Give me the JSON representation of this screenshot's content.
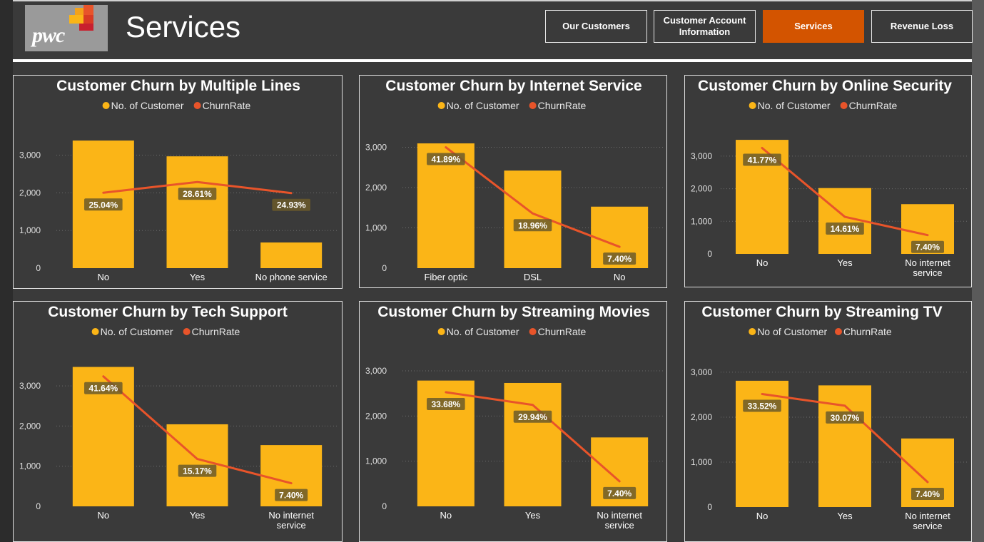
{
  "header": {
    "title": "Services",
    "logo_text": "pwc",
    "nav": [
      {
        "label": "Our Customers",
        "active": false
      },
      {
        "label": "Customer Account Information",
        "active": false
      },
      {
        "label": "Services",
        "active": true
      },
      {
        "label": "Revenue Loss",
        "active": false
      }
    ]
  },
  "colors": {
    "bar": "#fbb517",
    "line": "#e8542a",
    "background": "#3a3a3a",
    "active_nav": "#d35400"
  },
  "chart_data": [
    {
      "type": "bar",
      "title": "Customer Churn by Multiple Lines",
      "legend": [
        "No. of Customer",
        "ChurnRate"
      ],
      "categories": [
        "No",
        "Yes",
        "No phone service"
      ],
      "category_lines": [
        [
          "No"
        ],
        [
          "Yes"
        ],
        [
          "No phone service"
        ]
      ],
      "series": [
        {
          "name": "No. of Customer",
          "values": [
            3390,
            2971,
            682
          ]
        },
        {
          "name": "ChurnRate",
          "values": [
            25.04,
            28.61,
            24.93
          ],
          "labels": [
            "25.04%",
            "28.61%",
            "24.93%"
          ]
        }
      ],
      "yticks": [
        "0",
        "1,000",
        "2,000",
        "3,000"
      ],
      "ylim": [
        0,
        3600
      ],
      "rate_range": [
        0,
        45
      ],
      "legend_position": "top-center"
    },
    {
      "type": "bar",
      "title": "Customer Churn by Internet Service",
      "legend": [
        "No. of Customer",
        "ChurnRate"
      ],
      "categories": [
        "Fiber optic",
        "DSL",
        "No"
      ],
      "category_lines": [
        [
          "Fiber optic"
        ],
        [
          "DSL"
        ],
        [
          "No"
        ]
      ],
      "series": [
        {
          "name": "No. of Customer",
          "values": [
            3096,
            2421,
            1526
          ]
        },
        {
          "name": "ChurnRate",
          "values": [
            41.89,
            18.96,
            7.4
          ],
          "labels": [
            "41.89%",
            "18.96%",
            "7.40%"
          ]
        }
      ],
      "yticks": [
        "0",
        "1,000",
        "2,000",
        "3,000"
      ],
      "ylim": [
        0,
        3150
      ],
      "rate_range": [
        0,
        44
      ],
      "legend_position": "top-center"
    },
    {
      "type": "bar",
      "title": "Customer Churn by Online Security",
      "legend": [
        "No. of Customer",
        "ChurnRate"
      ],
      "categories": [
        "No",
        "Yes",
        "No internet service"
      ],
      "category_lines": [
        [
          "No"
        ],
        [
          "Yes"
        ],
        [
          "No internet",
          "service"
        ]
      ],
      "series": [
        {
          "name": "No. of Customer",
          "values": [
            3498,
            2019,
            1526
          ]
        },
        {
          "name": "ChurnRate",
          "values": [
            41.77,
            14.61,
            7.4
          ],
          "labels": [
            "41.77%",
            "14.61%",
            "7.40%"
          ]
        }
      ],
      "yticks": [
        "0",
        "1,000",
        "2,000",
        "3,000"
      ],
      "ylim": [
        0,
        3500
      ],
      "rate_range": [
        0,
        45
      ],
      "legend_position": "top-center"
    },
    {
      "type": "bar",
      "title": "Customer Churn by Tech Support",
      "legend": [
        "No. of Customer",
        "ChurnRate"
      ],
      "categories": [
        "No",
        "Yes",
        "No internet service"
      ],
      "category_lines": [
        [
          "No"
        ],
        [
          "Yes"
        ],
        [
          "No internet",
          "service"
        ]
      ],
      "series": [
        {
          "name": "No. of Customer",
          "values": [
            3473,
            2044,
            1526
          ]
        },
        {
          "name": "ChurnRate",
          "values": [
            41.64,
            15.17,
            7.4
          ],
          "labels": [
            "41.64%",
            "15.17%",
            "7.40%"
          ]
        }
      ],
      "yticks": [
        "0",
        "1,000",
        "2,000",
        "3,000"
      ],
      "ylim": [
        0,
        3500
      ],
      "rate_range": [
        0,
        45
      ],
      "legend_position": "top-center"
    },
    {
      "type": "bar",
      "title": "Customer Churn by Streaming Movies",
      "legend": [
        "No. of Customer",
        "ChurnRate"
      ],
      "categories": [
        "No",
        "Yes",
        "No internet service"
      ],
      "category_lines": [
        [
          "No"
        ],
        [
          "Yes"
        ],
        [
          "No internet",
          "service"
        ]
      ],
      "series": [
        {
          "name": "No. of Customer",
          "values": [
            2785,
            2732,
            1526
          ]
        },
        {
          "name": "ChurnRate",
          "values": [
            33.68,
            29.94,
            7.4
          ],
          "labels": [
            "33.68%",
            "29.94%",
            "7.40%"
          ]
        }
      ],
      "yticks": [
        "0",
        "1,000",
        "2,000",
        "3,000"
      ],
      "ylim": [
        0,
        3300
      ],
      "rate_range": [
        0,
        44
      ],
      "legend_position": "top-center"
    },
    {
      "type": "bar",
      "title": "Customer Churn by Streaming TV",
      "legend": [
        "No of Customer",
        "ChurnRate"
      ],
      "categories": [
        "No",
        "Yes",
        "No internet service"
      ],
      "category_lines": [
        [
          "No"
        ],
        [
          "Yes"
        ],
        [
          "No internet",
          "service"
        ]
      ],
      "series": [
        {
          "name": "No of Customer",
          "values": [
            2810,
            2707,
            1526
          ]
        },
        {
          "name": "ChurnRate",
          "values": [
            33.52,
            30.07,
            7.4
          ],
          "labels": [
            "33.52%",
            "30.07%",
            "7.40%"
          ]
        }
      ],
      "yticks": [
        "0",
        "1,000",
        "2,000",
        "3,000"
      ],
      "ylim": [
        0,
        3300
      ],
      "rate_range": [
        0,
        44
      ],
      "legend_position": "top-center"
    }
  ]
}
